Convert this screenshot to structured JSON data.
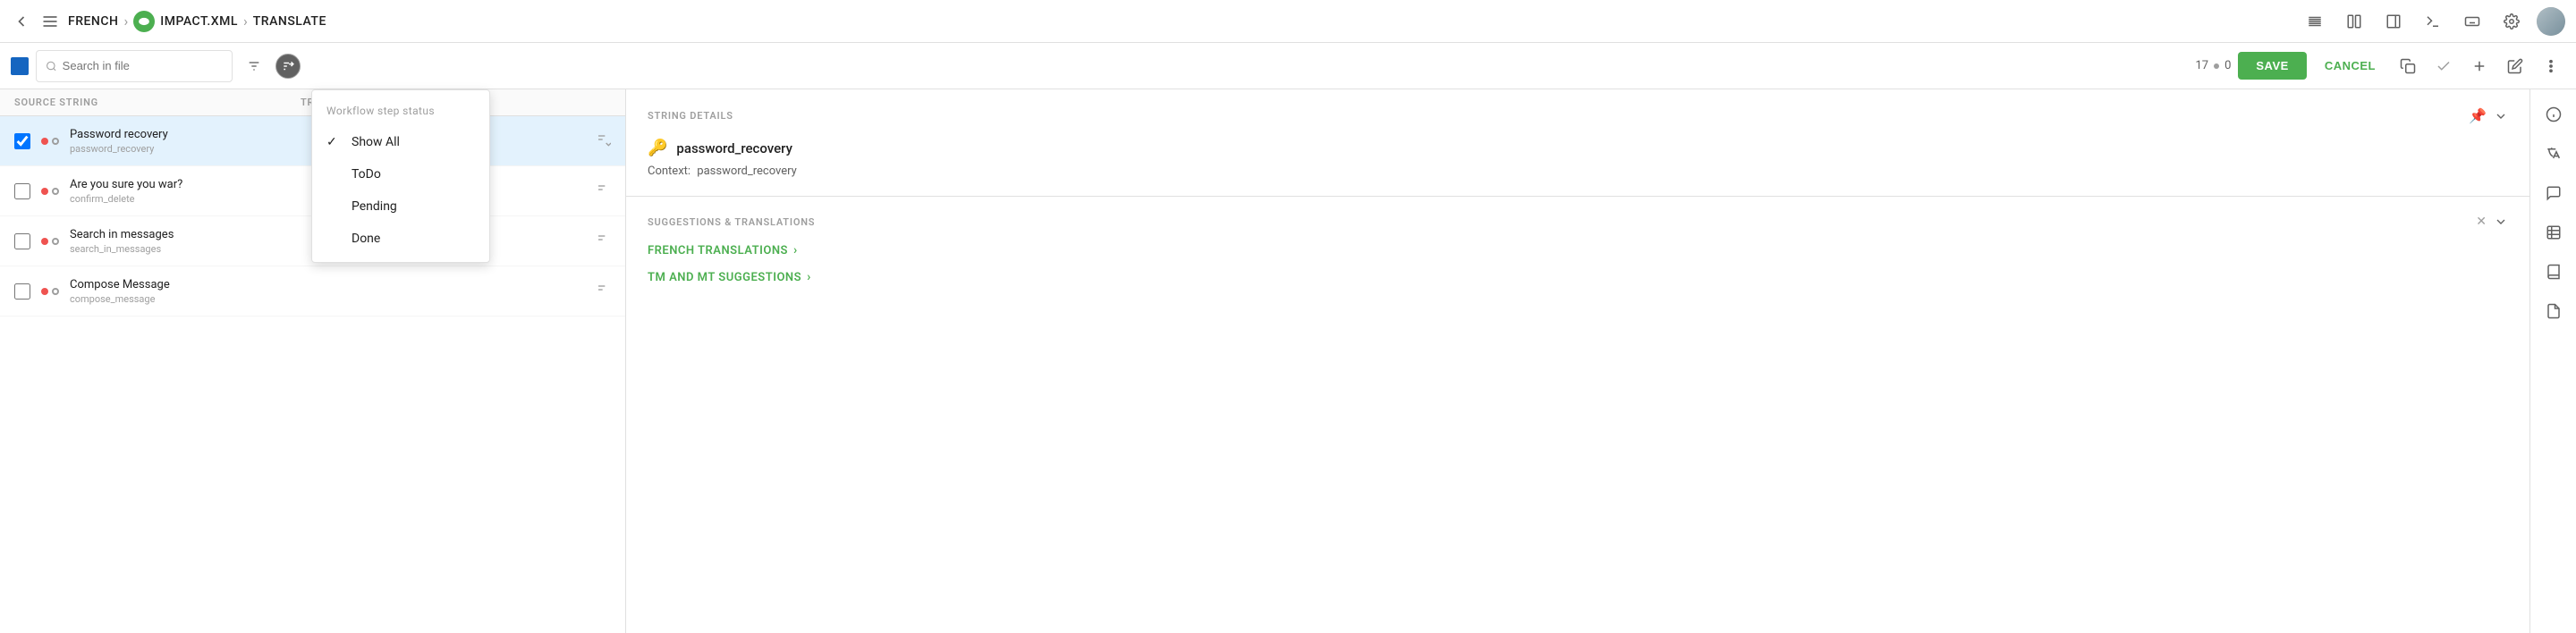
{
  "topnav": {
    "back_icon": "←",
    "hamburger_icon": "☰",
    "breadcrumb": [
      {
        "label": "FRENCH"
      },
      {
        "sep": "›"
      },
      {
        "label": "IMPACT.XML"
      },
      {
        "sep": "›"
      },
      {
        "label": "TRANSLATE"
      }
    ],
    "project_icon_label": "IMP"
  },
  "toolbar": {
    "search_placeholder": "Search in file",
    "counter_left": "17",
    "counter_sep": "•",
    "counter_right": "0",
    "save_label": "SAVE",
    "cancel_label": "CANCEL"
  },
  "list_header": {
    "col_source": "SOURCE STRING",
    "col_translation": "TRANSLATION"
  },
  "strings": [
    {
      "key": "Password recovery",
      "subkey": "password_recovery",
      "checked": true
    },
    {
      "key": "Are you sure you war",
      "subkey": "confirm_delete",
      "checked": false,
      "has_question": true
    },
    {
      "key": "Search in messages",
      "subkey": "search_in_messages",
      "checked": false
    },
    {
      "key": "Compose Message",
      "subkey": "compose_message",
      "checked": false
    }
  ],
  "dropdown": {
    "title": "Workflow step status",
    "items": [
      {
        "label": "Show All",
        "checked": true
      },
      {
        "label": "ToDo",
        "checked": false
      },
      {
        "label": "Pending",
        "checked": false
      },
      {
        "label": "Done",
        "checked": false
      }
    ]
  },
  "string_details": {
    "section_title": "STRING DETAILS",
    "key_icon": "🔑",
    "key_name": "password_recovery",
    "context_label": "Context:",
    "context_value": "password_recovery"
  },
  "suggestions": {
    "section_title": "SUGGESTIONS & TRANSLATIONS",
    "link1": "FRENCH TRANSLATIONS",
    "link2": "TM AND MT SUGGESTIONS"
  }
}
